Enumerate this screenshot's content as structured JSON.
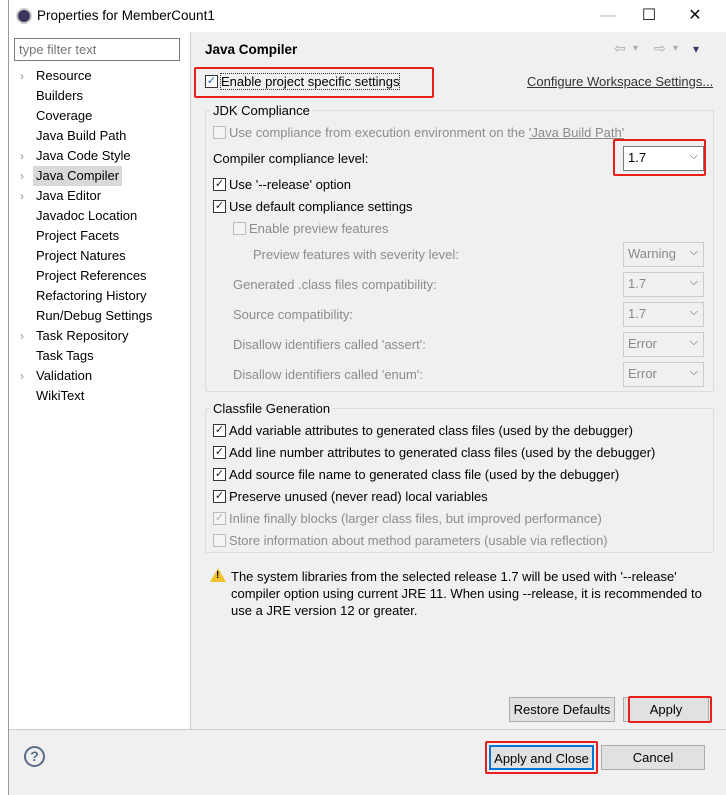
{
  "window": {
    "title": "Properties for MemberCount1",
    "minimize": "—",
    "maximize": "☐",
    "close": "✕"
  },
  "filter": {
    "placeholder": "type filter text"
  },
  "tree": [
    {
      "label": "Resource",
      "expandable": true
    },
    {
      "label": "Builders",
      "expandable": false
    },
    {
      "label": "Coverage",
      "expandable": false
    },
    {
      "label": "Java Build Path",
      "expandable": false
    },
    {
      "label": "Java Code Style",
      "expandable": true
    },
    {
      "label": "Java Compiler",
      "expandable": true,
      "selected": true
    },
    {
      "label": "Java Editor",
      "expandable": true
    },
    {
      "label": "Javadoc Location",
      "expandable": false
    },
    {
      "label": "Project Facets",
      "expandable": false
    },
    {
      "label": "Project Natures",
      "expandable": false
    },
    {
      "label": "Project References",
      "expandable": false
    },
    {
      "label": "Refactoring History",
      "expandable": false
    },
    {
      "label": "Run/Debug Settings",
      "expandable": false
    },
    {
      "label": "Task Repository",
      "expandable": true
    },
    {
      "label": "Task Tags",
      "expandable": false
    },
    {
      "label": "Validation",
      "expandable": true
    },
    {
      "label": "WikiText",
      "expandable": false
    }
  ],
  "page": {
    "title": "Java Compiler",
    "nav_back": "⇦",
    "nav_fwd": "⇨",
    "nav_dd": "▾",
    "menu": "▾",
    "enable_specific": {
      "label": "Enable project specific settings",
      "checked": true
    },
    "configure_link": "Configure Workspace Settings...",
    "jdk": {
      "group_label": "JDK Compliance",
      "use_ee": {
        "label_pre": "Use compliance from execution environment on the ",
        "link": "'Java Build Path'",
        "checked": false,
        "enabled": false
      },
      "level_label": "Compiler compliance level:",
      "level_value": "1.7",
      "use_release": {
        "label": "Use '--release' option",
        "checked": true
      },
      "use_default": {
        "label": "Use default compliance settings",
        "checked": true
      },
      "preview": {
        "label": "Enable preview features",
        "checked": false
      },
      "preview_sev_label": "Preview features with severity level:",
      "preview_sev_value": "Warning",
      "generated_label": "Generated .class files compatibility:",
      "generated_value": "1.7",
      "source_label": "Source compatibility:",
      "source_value": "1.7",
      "assert_label": "Disallow identifiers called 'assert':",
      "assert_value": "Error",
      "enum_label": "Disallow identifiers called 'enum':",
      "enum_value": "Error"
    },
    "classfile": {
      "group_label": "Classfile Generation",
      "items": [
        {
          "label": "Add variable attributes to generated class files (used by the debugger)",
          "checked": true,
          "enabled": true
        },
        {
          "label": "Add line number attributes to generated class files (used by the debugger)",
          "checked": true,
          "enabled": true
        },
        {
          "label": "Add source file name to generated class file (used by the debugger)",
          "checked": true,
          "enabled": true
        },
        {
          "label": "Preserve unused (never read) local variables",
          "checked": true,
          "enabled": true
        },
        {
          "label": "Inline finally blocks (larger class files, but improved performance)",
          "checked": true,
          "enabled": false
        },
        {
          "label": "Store information about method parameters (usable via reflection)",
          "checked": false,
          "enabled": false
        }
      ]
    },
    "warning": "The system libraries from the selected release 1.7 will be used with '--release' compiler option using current JRE 11. When using --release, it is recommended to use a JRE version 12 or greater.",
    "restore_defaults": "Restore Defaults",
    "apply": "Apply"
  },
  "footer": {
    "help": "?",
    "apply_close": "Apply and Close",
    "cancel": "Cancel"
  },
  "colors": {
    "highlight": "#e8201c",
    "accent": "#0078d7",
    "warning": "#f2c12e"
  }
}
